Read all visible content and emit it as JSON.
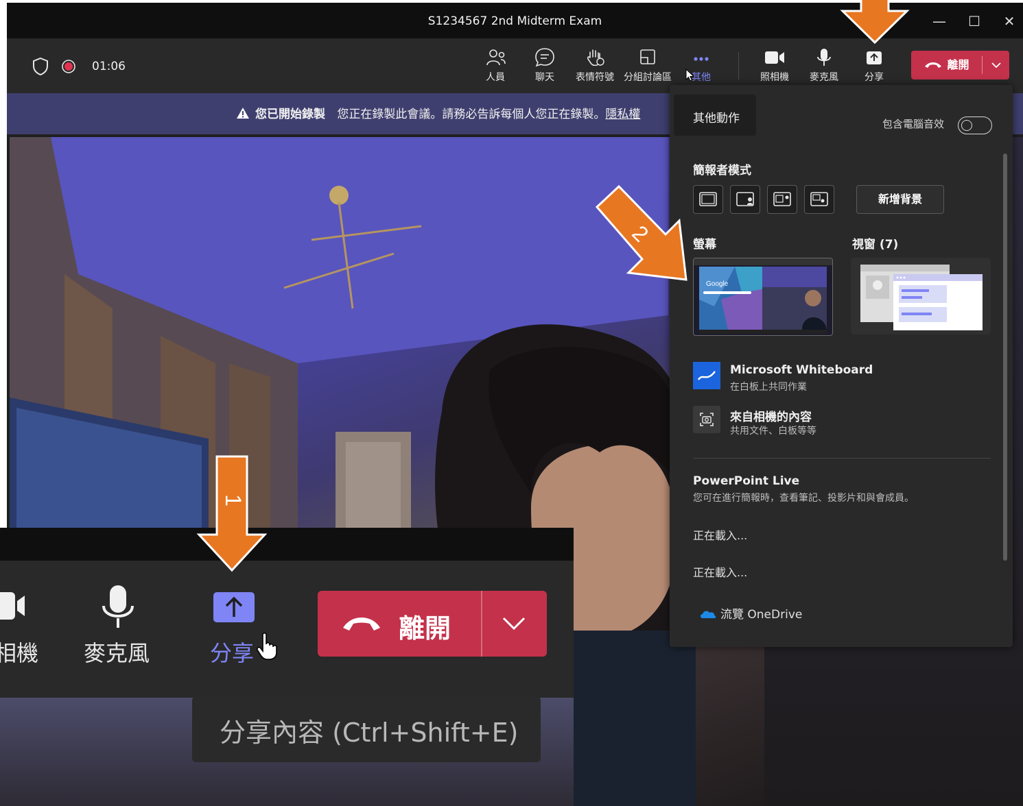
{
  "window": {
    "title": "S1234567 2nd Midterm Exam",
    "controls": {
      "minimize": "—",
      "maximize": "☐",
      "close": "✕"
    }
  },
  "toolbar": {
    "timer": "01:06",
    "buttons": [
      {
        "label": "人員",
        "icon": "people-icon"
      },
      {
        "label": "聊天",
        "icon": "chat-icon"
      },
      {
        "label": "表情符號",
        "icon": "raise-hand-icon"
      },
      {
        "label": "分組討論區",
        "icon": "breakout-rooms-icon"
      },
      {
        "label": "其他",
        "icon": "more-icon"
      },
      {
        "label": "照相機",
        "icon": "camera-icon"
      },
      {
        "label": "麥克風",
        "icon": "microphone-icon"
      },
      {
        "label": "分享",
        "icon": "share-icon"
      }
    ],
    "leave_label": "離開"
  },
  "banner": {
    "title": "您已開始錄製",
    "message": "您正在錄製此會議。請務必告訴每個人您正在錄製。",
    "link": "隱私權"
  },
  "panel": {
    "tooltip": "其他動作",
    "include_audio_label": "包含電腦音效",
    "include_audio_on": false,
    "presenter_mode_heading": "簡報者模式",
    "new_background_label": "新增背景",
    "screen_heading": "螢幕",
    "window_heading": "視窗 (7)",
    "screen_thumb_text": "Google",
    "options": [
      {
        "title": "Microsoft Whiteboard",
        "subtitle": "在白板上共同作業",
        "icon": "whiteboard-icon"
      },
      {
        "title": "來自相機的內容",
        "subtitle": "共用文件、白板等等",
        "icon": "camera-content-icon"
      }
    ],
    "powerpoint_heading": "PowerPoint Live",
    "powerpoint_desc": "您可在進行簡報時，查看筆記、投影片和與會成員。",
    "loading": [
      "正在載入...",
      "正在載入..."
    ],
    "onedrive_label": "流覽 OneDrive"
  },
  "zoom_inset": {
    "camera_label": "相機",
    "mic_label": "麥克風",
    "share_label": "分享",
    "leave_label": "離開",
    "tooltip": "分享內容 (Ctrl+Shift+E)"
  },
  "annotations": {
    "arrow1_label": "1",
    "arrow2_label": "2",
    "color": "#e87722"
  },
  "colors": {
    "leave": "#c4314b",
    "banner": "#3f3f6f",
    "accent": "#7f85f5"
  }
}
